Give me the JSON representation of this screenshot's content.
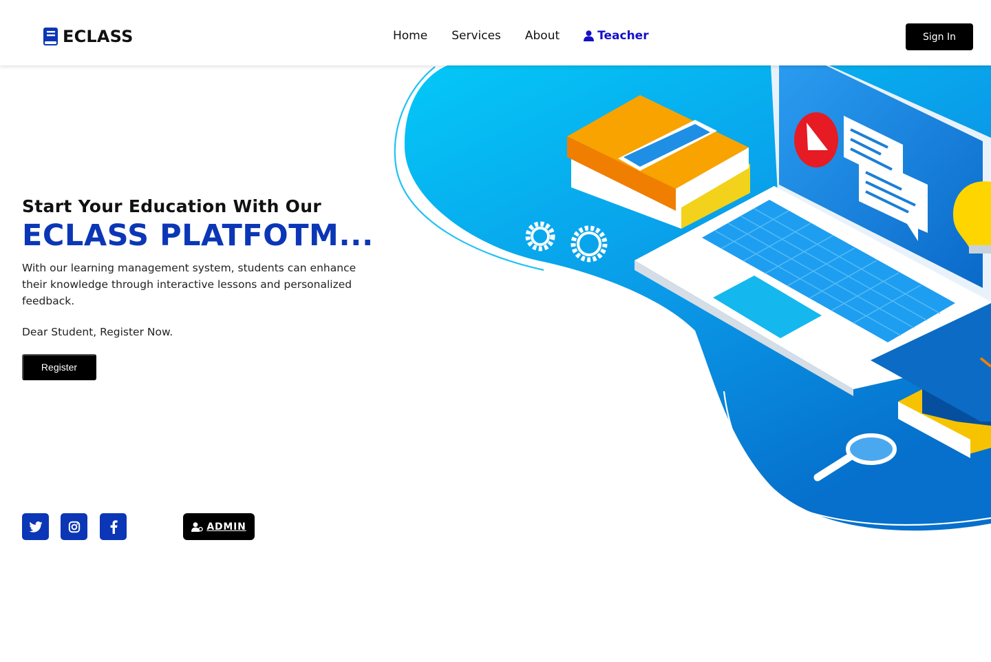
{
  "brand": {
    "name": "ECLASS",
    "icon": "book-icon",
    "color": "#0b37b6"
  },
  "nav": {
    "home": "Home",
    "services": "Services",
    "about": "About",
    "teacher": "Teacher",
    "teacher_icon": "user-icon",
    "teacher_color": "#1410c9",
    "signin": "Sign In"
  },
  "hero": {
    "kicker": "Start Your Education With Our",
    "title": "ECLASS PLATFOTM...",
    "description": "With our learning management system, students can enhance their knowledge through interactive lessons and personalized feedback.",
    "cta_text": "Dear Student, Register Now.",
    "register_label": "Register"
  },
  "social": [
    {
      "name": "twitter",
      "icon": "twitter-icon"
    },
    {
      "name": "instagram",
      "icon": "instagram-icon"
    },
    {
      "name": "facebook",
      "icon": "facebook-icon"
    }
  ],
  "admin": {
    "label": "ADMIN",
    "icon": "admin-user-icon"
  },
  "colors": {
    "accent": "#0b37b6",
    "illustration_blue": "#0a8ae0",
    "illustration_cyan": "#00c4f5",
    "button": "#000000"
  }
}
